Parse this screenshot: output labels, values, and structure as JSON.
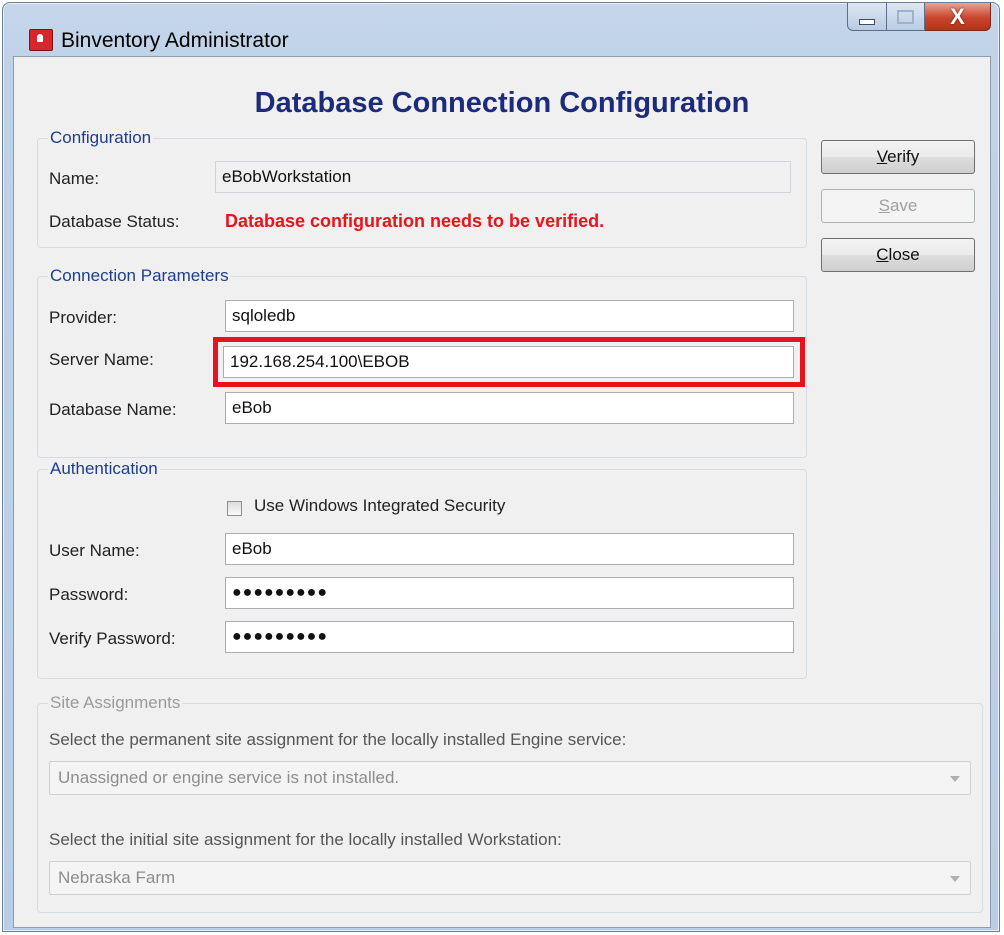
{
  "window": {
    "title": "Binventory Administrator",
    "close_glyph": "X"
  },
  "header": {
    "title": "Database Connection Configuration"
  },
  "configuration": {
    "legend": "Configuration",
    "name_label": "Name:",
    "name_value": "eBobWorkstation",
    "status_label": "Database Status:",
    "status_value": "Database configuration needs to be verified."
  },
  "connection": {
    "legend": "Connection Parameters",
    "provider_label": "Provider:",
    "provider_value": "sqloledb",
    "server_label": "Server Name:",
    "server_value": "192.168.254.100\\EBOB",
    "database_label": "Database Name:",
    "database_value": "eBob"
  },
  "authentication": {
    "legend": "Authentication",
    "windows_security_label": "Use Windows Integrated Security",
    "windows_security_checked": false,
    "user_label": "User Name:",
    "user_value": "eBob",
    "password_label": "Password:",
    "password_value": "●●●●●●●●●",
    "verify_label": "Verify Password:",
    "verify_value": "●●●●●●●●●"
  },
  "site": {
    "legend": "Site Assignments",
    "engine_label": "Select the permanent site assignment for the locally installed Engine service:",
    "engine_value": "Unassigned or engine service is not installed.",
    "workstation_label": "Select the initial site assignment for the locally installed Workstation:",
    "workstation_value": "Nebraska Farm"
  },
  "buttons": {
    "verify": {
      "mnemonic": "V",
      "rest": "erify"
    },
    "save": {
      "mnemonic": "S",
      "rest": "ave"
    },
    "close": {
      "mnemonic": "C",
      "rest": "lose"
    }
  },
  "colors": {
    "title_blue": "#1c2c7a",
    "legend_blue": "#1e3d8f",
    "status_red": "#e8141a",
    "highlight_red": "#e5131b"
  },
  "icons": {
    "app": "binventory-app-icon",
    "minimize": "minimize-icon",
    "maximize": "maximize-icon",
    "close": "close-icon",
    "dropdown": "chevron-down-icon"
  }
}
